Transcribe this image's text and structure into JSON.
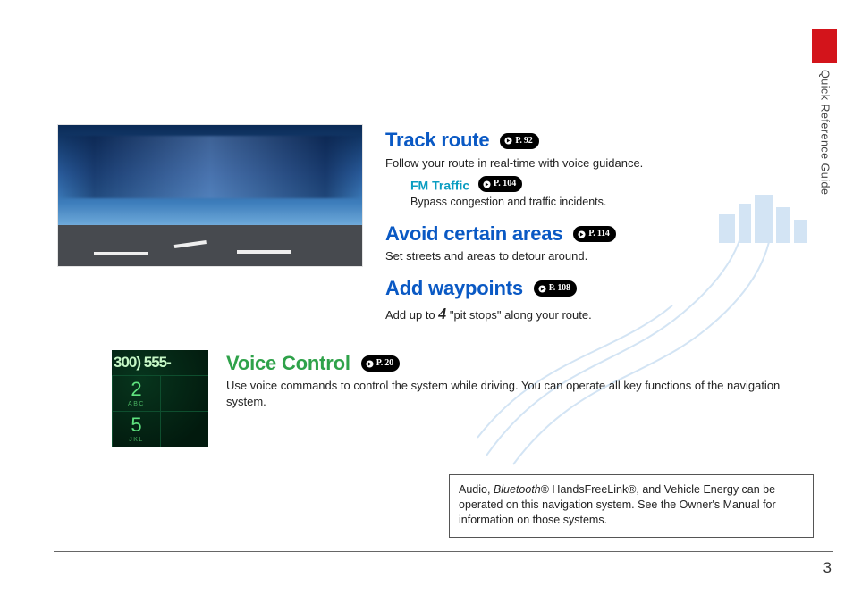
{
  "side_title": "Quick Reference Guide",
  "page_number": "3",
  "sections": {
    "track": {
      "title": "Track route",
      "page_ref": "P. 92",
      "desc": "Follow your route in real-time with voice guidance.",
      "fm_title": "FM Traffic",
      "fm_page_ref": "P. 104",
      "fm_desc": "Bypass congestion and traffic incidents."
    },
    "avoid": {
      "title": "Avoid certain areas",
      "page_ref": "P. 114",
      "desc": "Set streets and areas to detour around."
    },
    "waypoints": {
      "title": "Add waypoints",
      "page_ref": "P. 108",
      "desc_pre": "Add up to ",
      "desc_num": "4",
      "desc_post": " \"pit stops\" along your route."
    },
    "voice": {
      "title": "Voice Control",
      "page_ref": "P. 20",
      "desc": "Use voice commands to control the system while driving. You can operate all key functions of the navigation system."
    }
  },
  "keypad": {
    "top": "300) 555-",
    "k2": "2",
    "k2l": "ABC",
    "k3": "",
    "k3l": "",
    "k5": "5",
    "k5l": "JKL",
    "k6": "",
    "k6l": ""
  },
  "footnote_html": "Audio, <em>Bluetooth</em>®  HandsFreeLink®, and Vehicle Energy can be operated on this navigation system. See the Owner's Manual for information on those systems."
}
